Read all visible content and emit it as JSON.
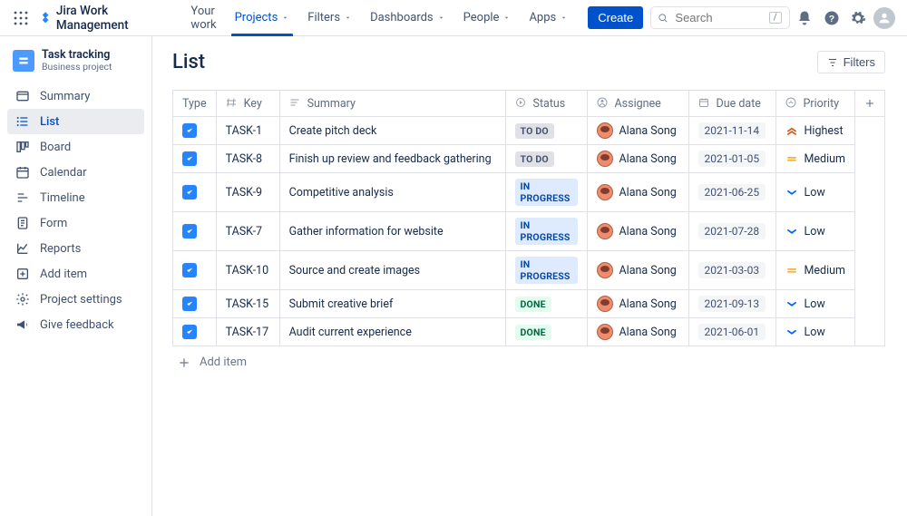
{
  "topnav": {
    "product_name": "Jira Work Management",
    "links": [
      {
        "label": "Your work",
        "dropdown": false,
        "active": false
      },
      {
        "label": "Projects",
        "dropdown": true,
        "active": true
      },
      {
        "label": "Filters",
        "dropdown": true,
        "active": false
      },
      {
        "label": "Dashboards",
        "dropdown": true,
        "active": false
      },
      {
        "label": "People",
        "dropdown": true,
        "active": false
      },
      {
        "label": "Apps",
        "dropdown": true,
        "active": false
      }
    ],
    "create_label": "Create",
    "search_placeholder": "Search",
    "search_shortcut": "/"
  },
  "sidebar": {
    "project_name": "Task tracking",
    "project_type": "Business project",
    "items": [
      {
        "label": "Summary",
        "icon": "summary"
      },
      {
        "label": "List",
        "icon": "list",
        "active": true
      },
      {
        "label": "Board",
        "icon": "board"
      },
      {
        "label": "Calendar",
        "icon": "calendar"
      },
      {
        "label": "Timeline",
        "icon": "timeline"
      },
      {
        "label": "Form",
        "icon": "form"
      },
      {
        "label": "Reports",
        "icon": "reports"
      },
      {
        "label": "Add item",
        "icon": "add"
      },
      {
        "label": "Project settings",
        "icon": "settings"
      },
      {
        "label": "Give feedback",
        "icon": "feedback"
      }
    ]
  },
  "page": {
    "title": "List",
    "filters_label": "Filters",
    "add_item_label": "Add item"
  },
  "table": {
    "headers": {
      "type": "Type",
      "key": "Key",
      "summary": "Summary",
      "status": "Status",
      "assignee": "Assignee",
      "due_date": "Due date",
      "priority": "Priority"
    },
    "rows": [
      {
        "key": "TASK-1",
        "summary": "Create pitch deck",
        "status": "TO DO",
        "status_kind": "todo",
        "assignee": "Alana Song",
        "due": "2021-11-14",
        "priority": "Highest",
        "priority_kind": "highest"
      },
      {
        "key": "TASK-8",
        "summary": "Finish up review and feedback gathering",
        "status": "TO DO",
        "status_kind": "todo",
        "assignee": "Alana Song",
        "due": "2021-01-05",
        "priority": "Medium",
        "priority_kind": "medium"
      },
      {
        "key": "TASK-9",
        "summary": "Competitive analysis",
        "status": "IN PROGRESS",
        "status_kind": "inprogress",
        "assignee": "Alana Song",
        "due": "2021-06-25",
        "priority": "Low",
        "priority_kind": "low"
      },
      {
        "key": "TASK-7",
        "summary": "Gather information for website",
        "status": "IN PROGRESS",
        "status_kind": "inprogress",
        "assignee": "Alana Song",
        "due": "2021-07-28",
        "priority": "Low",
        "priority_kind": "low"
      },
      {
        "key": "TASK-10",
        "summary": "Source and create images",
        "status": "IN PROGRESS",
        "status_kind": "inprogress",
        "assignee": "Alana Song",
        "due": "2021-03-03",
        "priority": "Medium",
        "priority_kind": "medium"
      },
      {
        "key": "TASK-15",
        "summary": "Submit creative brief",
        "status": "DONE",
        "status_kind": "done",
        "assignee": "Alana Song",
        "due": "2021-09-13",
        "priority": "Low",
        "priority_kind": "low"
      },
      {
        "key": "TASK-17",
        "summary": "Audit current experience",
        "status": "DONE",
        "status_kind": "done",
        "assignee": "Alana Song",
        "due": "2021-06-01",
        "priority": "Low",
        "priority_kind": "low"
      }
    ]
  }
}
